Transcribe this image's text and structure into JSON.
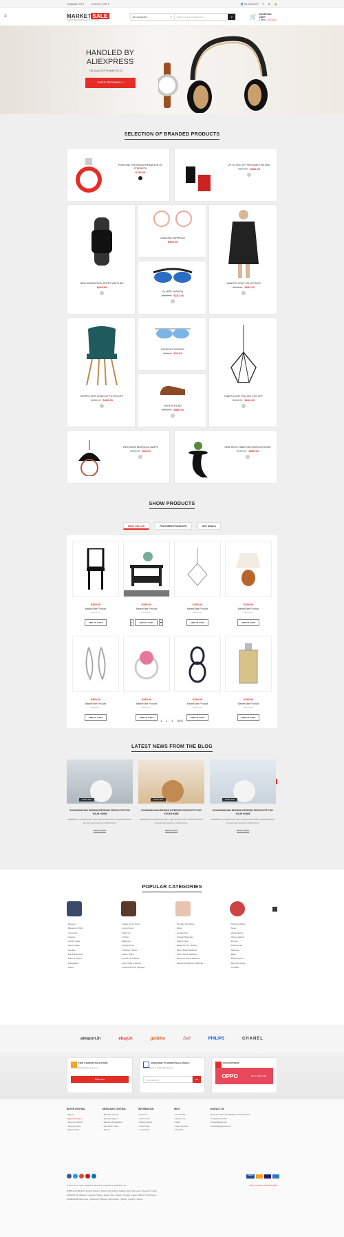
{
  "topbar": {
    "language_label": "Language:",
    "language_value": "EN",
    "currency_label": "Currency:",
    "currency_value": "USD",
    "account": "My Account"
  },
  "header": {
    "logo_a": "MARKET",
    "logo_b": "SALE",
    "logo_sub": "AWESOME SHOPPING WITH US TODAY",
    "category": "All Categories",
    "search_placeholder": "What are you looking for?",
    "cart_title": "SHOPPING CART",
    "cart_count": "2 item",
    "cart_amount": "$370.00"
  },
  "hero": {
    "line1": "HANDLED BY",
    "line2": "ALIEXPRESS",
    "sub": "ON SALE SEPTEMBER 20-24",
    "button": "SUPER SEPTEMBER"
  },
  "branded": {
    "title": "SELECTION OF BRANDED PRODUCTS",
    "items": [
      {
        "name": "PERFUME FOR MEN AFFIRMATION OF STRENGTH",
        "old": "",
        "price": "$150.00"
      },
      {
        "name": "UP TO 30% OFF PERFUME FOR MEN",
        "old": "$450.00",
        "price": "$300.00"
      },
      {
        "name": "NEW GENERATION SPORT WATCHES",
        "old": "",
        "price": "$249.95"
      },
      {
        "name": "DIAMOND EARRINGS",
        "old": "",
        "price": "$999.95"
      },
      {
        "name": "MANGTO COAT COLLECTION",
        "old": "$590.00",
        "price": "$542.00"
      },
      {
        "name": "GLASSE FASHION",
        "old": "$220.00",
        "price": "$187.00"
      },
      {
        "name": "SUPER LIGHT CHAIR UP TO 50% OFF",
        "old": "$800.00",
        "price": "$400.00"
      },
      {
        "name": "FASHION EYEWEAR",
        "old": "$30.00",
        "price": "$26.00"
      },
      {
        "name": "LAMPS LIGHT YELLOW -10% OFF",
        "old": "$250.00",
        "price": "$231.00"
      },
      {
        "name": "SHOE KOH-IND",
        "old": "$600.00",
        "price": "$580.00"
      },
      {
        "name": "TWO-MODE BEDROOM LAMPS",
        "old": "$100.00",
        "price": "$69.00"
      },
      {
        "name": "NEW DECO TABLE DECORATION ROOM",
        "old": "$410.00",
        "price": "$350.00"
      }
    ]
  },
  "show": {
    "title": "SHOW PRODUCTS",
    "tabs": [
      "BEST SELLER",
      "FEATURED PRODUCTS",
      "HOT DEALS"
    ],
    "price": "$359.00",
    "name": "MarketSale Product",
    "cat": "Fashion Lc",
    "add": "ADD TO CART",
    "pager": [
      "1",
      "2",
      "3",
      "NEXT"
    ]
  },
  "blog": {
    "title": "LATEST NEWS FROM THE BLOG",
    "date": "26 Dec 2017",
    "post_title": "SCANDINAVIAN DESIGN INTERIOR PRODUCTS FOR YOUR HOME",
    "post_text": "Phasellus ut condimentum diam, eget tempus lorem. Morbi bibendum est quis arcu posuere condimentum.",
    "read_more": "READ MORE"
  },
  "popular": {
    "title": "POPULAR CATEGORIES",
    "cols": [
      [
        "Dresses",
        "Blouses & Shirts",
        "Jumpsuits",
        "Jackets",
        "Trench Coats",
        "Caps & Hats",
        "Hoodies",
        "Bra & Brief Sets",
        "Pants & Capris",
        "Sunglasses",
        "Socks"
      ],
      [
        "Space Home Store",
        "Living Room",
        "Bedroom",
        "Kitchen",
        "Bathroom",
        "Dining Room",
        "Children's Room",
        "Home Office",
        "Garden & Outdoor",
        "Arts,Crafts & Sewing",
        "Festive & Party Supplies"
      ],
      [
        "Pendant Necklaces",
        "Rings",
        "Hot Earrings",
        "Popular Bracelets",
        "Jewelry Sets",
        "Beads for DIY Jewelry",
        "Men's Brand Watches",
        "Men's Sports Watches",
        "Women's Brand Watches",
        "Selected Children's Watches"
      ],
      [
        "Shopping Bags",
        "Totes",
        "Hiking Shoes",
        "Hiking Jackets",
        "Fitness",
        "Fishing Lure",
        "Swimsuit",
        "Bikini",
        "Board Games",
        "Running Shoes",
        "Yoli Bike"
      ]
    ]
  },
  "brands": [
    "amazon.in",
    "ebay.in",
    "goibibo",
    "Dell",
    "PHILIPS",
    "CHANEL"
  ],
  "promo": [
    {
      "title": "FIND A MARKETSALE STORE",
      "desc": "Find Marketsale store near you",
      "button": "Click here"
    },
    {
      "title": "SUBSCRIBE TO MARKETSALE EMAILS",
      "desc": "Lorem ipsum is simply dummy text",
      "placeholder": "Email address",
      "button": "OK"
    },
    {
      "title": "OUR PARTNERS",
      "banner": "OPPO",
      "banner_text": "UP TO 30% OFF"
    }
  ],
  "footer": {
    "cols": [
      {
        "title": "BUYER CENTRAL",
        "items": [
          "Sign In",
          "Buyer Protection",
          "Payment Options",
          "Shipping Policy",
          "Return Policy"
        ]
      },
      {
        "title": "MERCHANT CENTRAL",
        "items": [
          "Merchant Central",
          "Merchant Sign In",
          "Merchant Registration",
          "New Deal in Bulk",
          "Pricing"
        ]
      },
      {
        "title": "INFORMATION",
        "items": [
          "About Us",
          "Term of Use",
          "Market Faculty",
          "Store Policy",
          "In the Press"
        ]
      },
      {
        "title": "HELP",
        "items": [
          "Get All Help",
          "My Account",
          "FAQs",
          "Other Services",
          "Shop Ent"
        ]
      },
      {
        "title": "CONTACT US",
        "items": [
          "Example Street 68, Mahattan, New York USA",
          "+ 00 (123) 45 678",
          "contact@sale.com",
          "marketsale@gmail.com"
        ]
      }
    ],
    "copyright": "© 2017 Demo Store. All Rights Reserved. Designed by TopDemo.com",
    "shop_phone": "Shop by phone: 1-800-123-2266",
    "links1": "MOBILE & TABLETS: Android Phones | Tablets with Calling | Tablets | iPad | Samsung | Micromax | Nokia",
    "links2": "FASHION: Sunglasses | Leggings | Sleep | Jeans | Tees | Jewelry | Sarees | Ladies Watches | Kids Jeans",
    "links3": "HOMEWARE: Bed Cover | Wall Clock | Bangles | Bed Sheets | Towels | Cushion | Pillows"
  }
}
